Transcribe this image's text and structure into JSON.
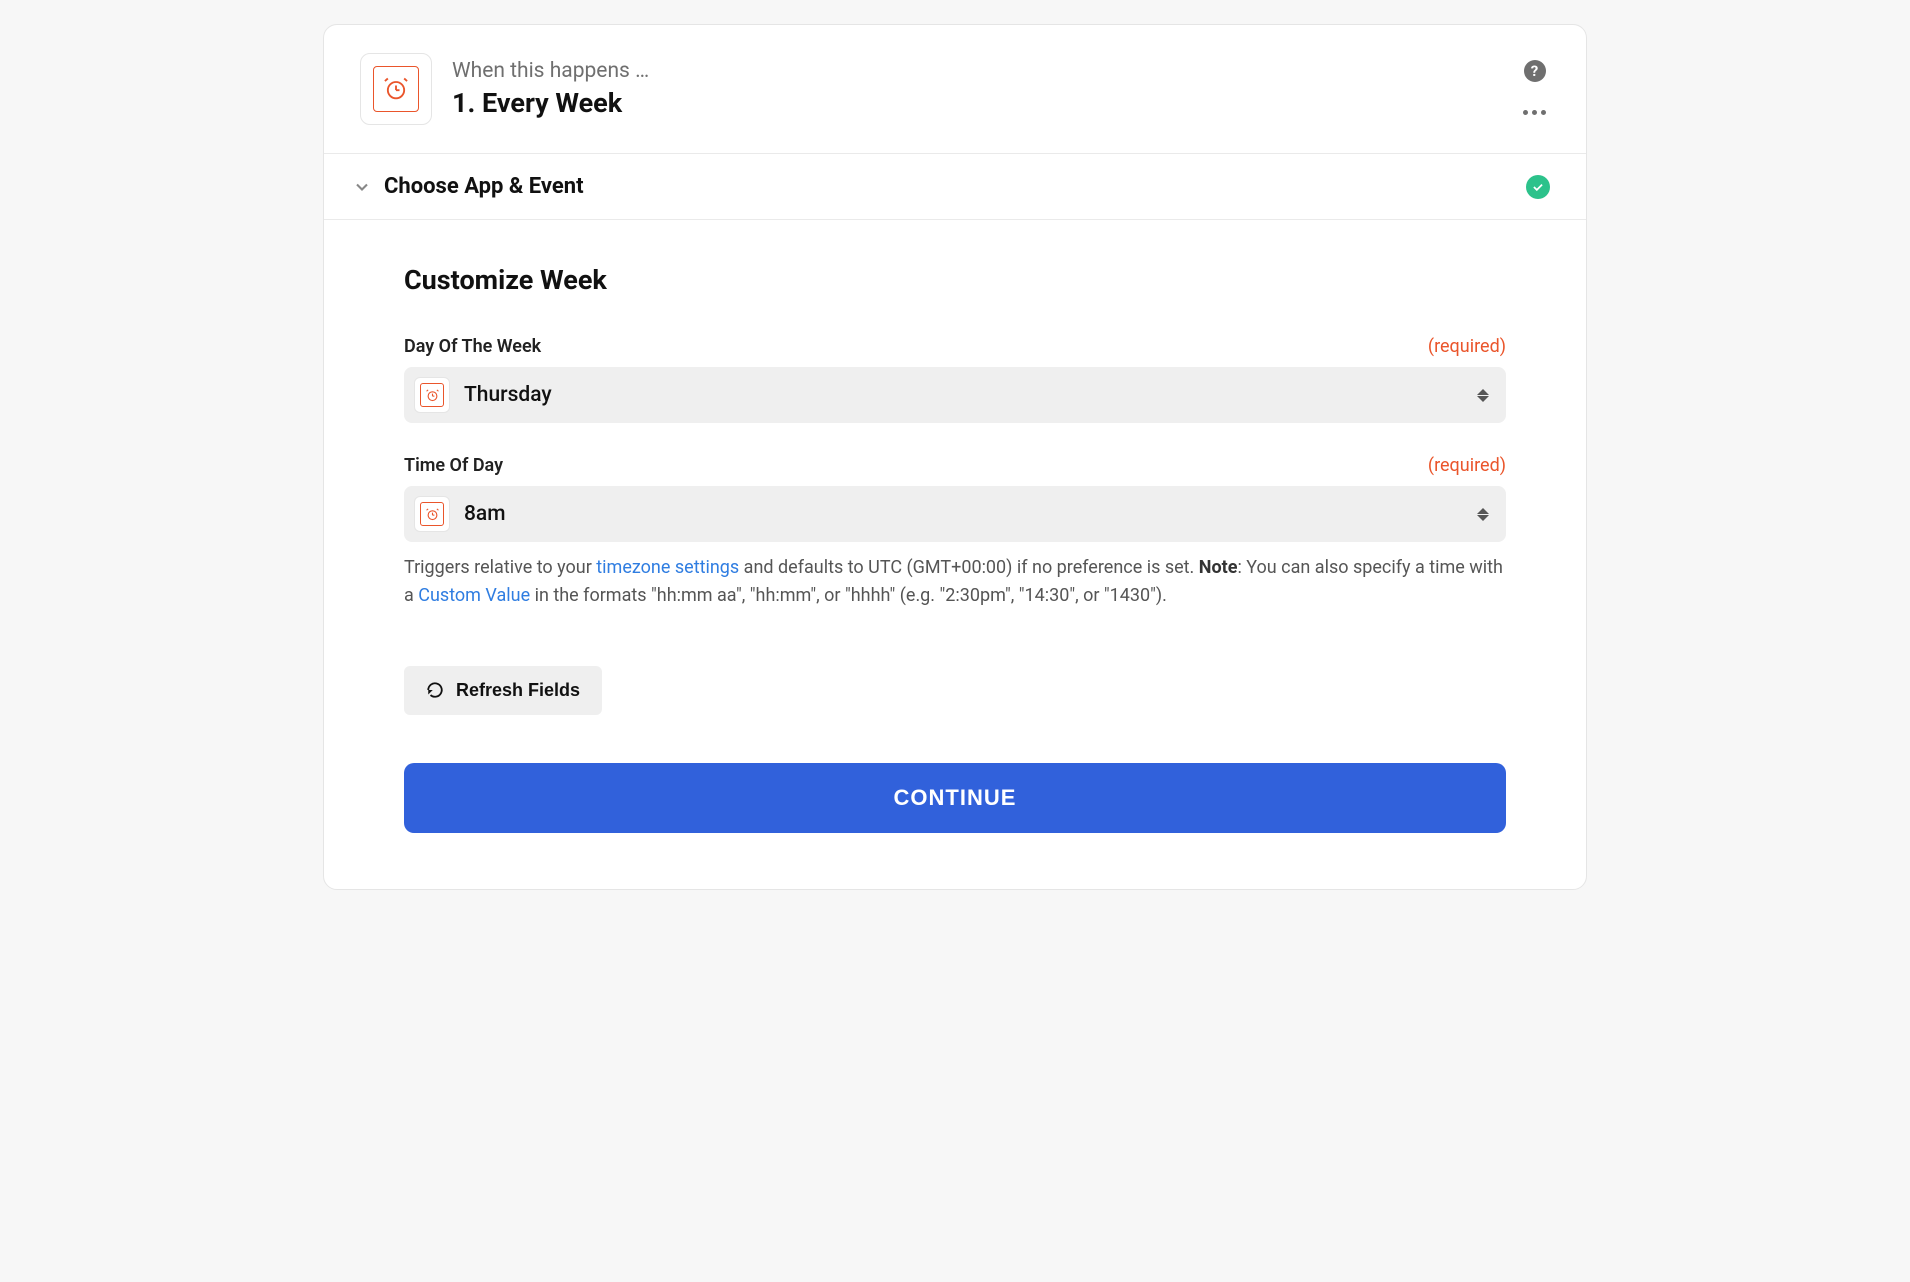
{
  "header": {
    "kicker": "When this happens …",
    "title": "1. Every Week"
  },
  "sections": {
    "choose_event": {
      "title": "Choose App & Event",
      "completed": true
    },
    "customize": {
      "title": "Customize Week",
      "fields": {
        "day": {
          "label": "Day Of The Week",
          "required_label": "(required)",
          "value": "Thursday"
        },
        "time": {
          "label": "Time Of Day",
          "required_label": "(required)",
          "value": "8am",
          "help": {
            "text_1": "Triggers relative to your ",
            "link_1": "timezone settings",
            "text_2": " and defaults to UTC (GMT+00:00) if no preference is set. ",
            "note_label": "Note",
            "text_3": ": You can also specify a time with a ",
            "link_2": "Custom Value",
            "text_4": " in the formats \"hh:mm aa\", \"hh:mm\", or \"hhhh\" (e.g. \"2:30pm\", \"14:30\", or \"1430\")."
          }
        }
      },
      "refresh_label": "Refresh Fields",
      "continue_label": "CONTINUE"
    }
  }
}
